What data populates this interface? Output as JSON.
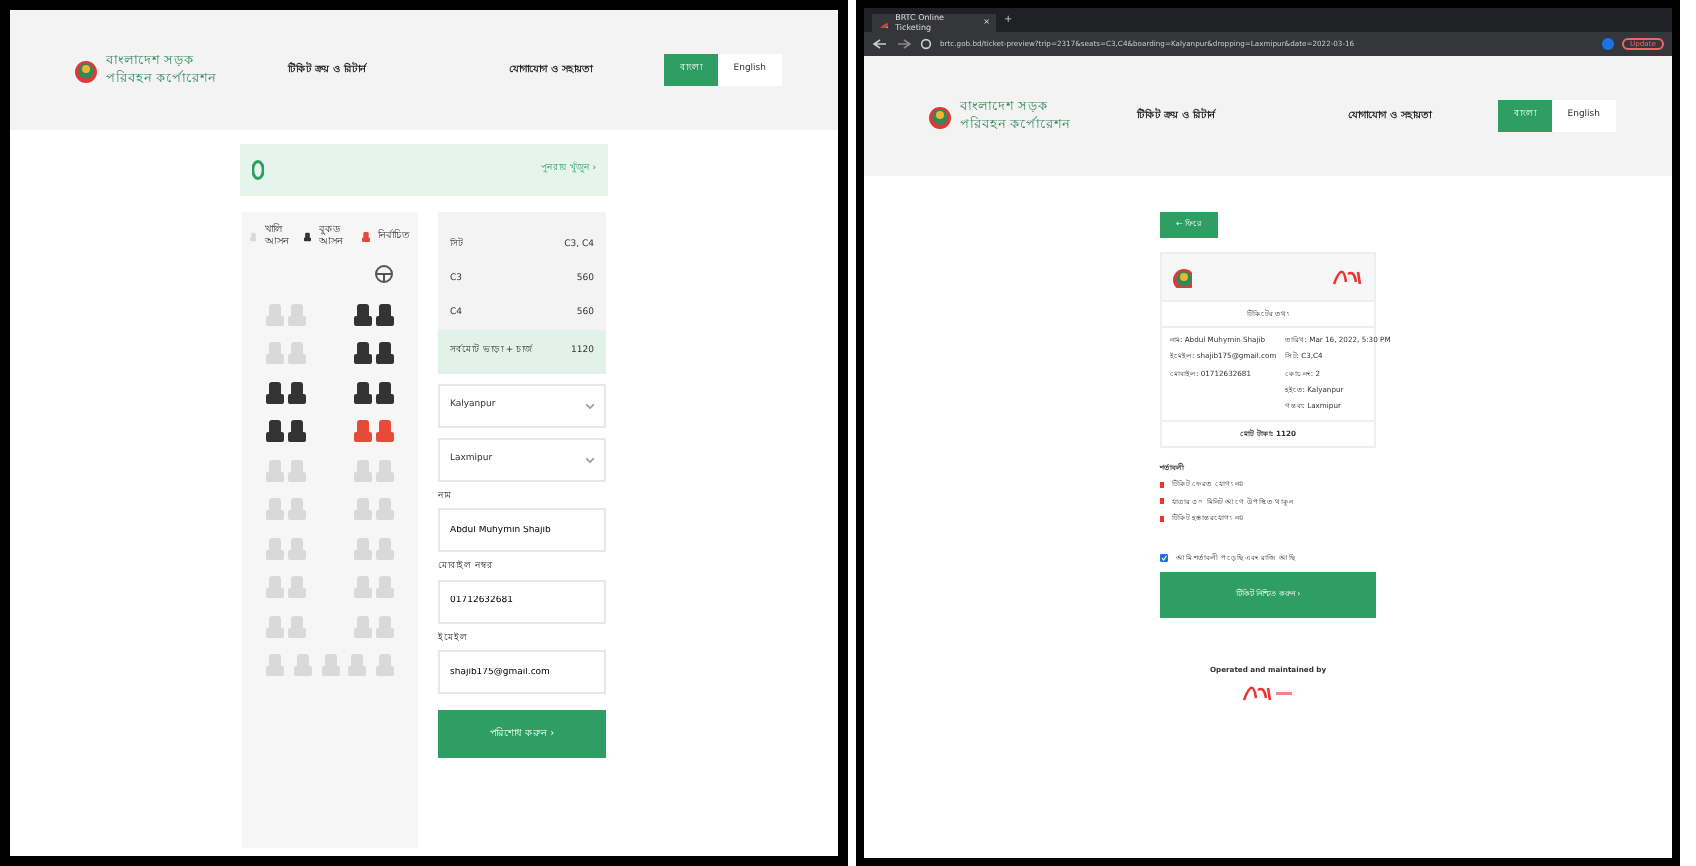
{
  "left_screen": {
    "header": {
      "logo_text": [
        "বাংলাদেশ সড়ক",
        "পরিবহন কর্পোরেশন"
      ],
      "nav": [
        "টিকিট ক্রয় ও রিটার্ন",
        "যোগাযোগ ও সহায়তা"
      ],
      "languages": [
        {
          "label": "বাংলা",
          "selected": true
        },
        {
          "label": "English",
          "selected": false
        }
      ]
    },
    "trip_bar": {
      "link": "পুনরায় খুঁজুন ›"
    },
    "legend": [
      {
        "label": "খালি আসন",
        "kind": "available"
      },
      {
        "label": "বুকড আসন",
        "kind": "booked"
      },
      {
        "label": "নির্বাচিত",
        "kind": "selected"
      }
    ],
    "seat_rows": [
      [
        {
          "kind": "available"
        },
        {
          "kind": "available"
        },
        {
          "kind": "booked"
        },
        {
          "kind": "booked"
        }
      ],
      [
        {
          "kind": "available"
        },
        {
          "kind": "available"
        },
        {
          "kind": "booked"
        },
        {
          "kind": "booked"
        }
      ],
      [
        {
          "kind": "booked"
        },
        {
          "kind": "booked"
        },
        {
          "kind": "booked"
        },
        {
          "kind": "booked"
        }
      ],
      [
        {
          "kind": "booked"
        },
        {
          "kind": "booked"
        },
        {
          "kind": "selected"
        },
        {
          "kind": "selected"
        }
      ],
      [
        {
          "kind": "available"
        },
        {
          "kind": "available"
        },
        {
          "kind": "available"
        },
        {
          "kind": "available"
        }
      ],
      [
        {
          "kind": "available"
        },
        {
          "kind": "available"
        },
        {
          "kind": "available"
        },
        {
          "kind": "available"
        }
      ],
      [
        {
          "kind": "available"
        },
        {
          "kind": "available"
        },
        {
          "kind": "available"
        },
        {
          "kind": "available"
        }
      ],
      [
        {
          "kind": "available"
        },
        {
          "kind": "available"
        },
        {
          "kind": "available"
        },
        {
          "kind": "available"
        }
      ],
      [
        {
          "kind": "available"
        },
        {
          "kind": "available"
        },
        {
          "kind": "available"
        },
        {
          "kind": "available"
        }
      ],
      [
        {
          "kind": "available"
        },
        {
          "kind": "available"
        },
        {
          "kind": "available"
        },
        {
          "kind": "available"
        },
        {
          "kind": "available"
        }
      ]
    ],
    "summary": [
      {
        "label": "সিট",
        "value": "C3, C4",
        "highlighted": false
      },
      {
        "label": "C3",
        "value": "560",
        "highlighted": false
      },
      {
        "label": "C4",
        "value": "560",
        "highlighted": false
      },
      {
        "label": "সর্বমোট ভাড়া + চার্জ",
        "value": "1120",
        "highlighted": true
      }
    ],
    "selects": [
      "Kalyanpur",
      "Laxmipur"
    ],
    "fields": [
      {
        "label": "নাম",
        "value": "Abdul Muhymin Shajib"
      },
      {
        "label": "মোবাইল নম্বর",
        "value": "01712632681"
      },
      {
        "label": "ইমেইল",
        "value": "shajib175@gmail.com"
      }
    ],
    "submit": "পরিশোধ করুন ›"
  },
  "right_screen": {
    "browser": {
      "tab_title": "BRTC Online Ticketing",
      "tab_close": "×",
      "new_tab": "+",
      "url": "brtc.gob.bd/ticket-preview?trip=2317&seats=C3,C4&boarding=Kalyanpur&dropping=Laxmipur&date=2022-03-16",
      "update": "Update"
    },
    "header": {
      "logo_text": [
        "বাংলাদেশ সড়ক",
        "পরিবহন কর্পোরেশন"
      ],
      "nav": [
        "টিকিট ক্রয় ও রিটার্ন",
        "যোগাযোগ ও সহায়তা"
      ],
      "languages": [
        {
          "label": "বাংলা",
          "selected": true
        },
        {
          "label": "English",
          "selected": false
        }
      ]
    },
    "back": "← ফিরে",
    "card": {
      "heading": "টিকিটের তথ্য",
      "left_details": [
        "নাম: Abdul Muhymin Shajib",
        "ইমেইল: shajib175@gmail.com",
        "মোবাইল: 01712632681"
      ],
      "right_details": [
        "তারিখ: Mar 16, 2022, 5:30 PM",
        "সিট: C3,C4",
        "কোচ নং: 2",
        "হইতে: Kalyanpur",
        "গন্তব্য: Laxmipur"
      ],
      "total": "মোট টাকা: 1120"
    },
    "terms_title": "শর্তাবলী",
    "terms": [
      "টিকিট ফেরত যোগ্য নয়",
      "যাত্রার ৩০ মিনিট আগে উপস্থিত থাকুন",
      "টিকিট হস্তান্তরযোগ্য নয়"
    ],
    "agreement": {
      "label": "আমি শর্তাবলী পড়েছি এবং রাজি আছি",
      "checked": true
    },
    "confirm": "টিকিট নিশ্চিত করুন ›",
    "footer": "Operated and maintained by"
  }
}
